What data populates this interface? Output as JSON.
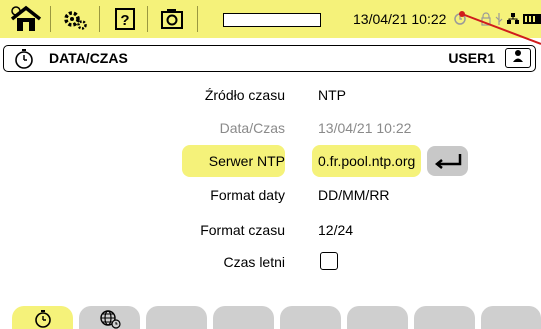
{
  "statusbar": {
    "datetime": "13/04/21 10:22",
    "progress_fraction": 0.0
  },
  "header": {
    "title": "DATA/CZAS",
    "user": "USER1"
  },
  "form": {
    "source_label": "Źródło czasu",
    "source_value": "NTP",
    "datetime_label": "Data/Czas",
    "datetime_value": "13/04/21 10:22",
    "ntp_label": "Serwer NTP",
    "ntp_value": "0.fr.pool.ntp.org",
    "date_format_label": "Format daty",
    "date_format_value": "DD/MM/RR",
    "time_format_label": "Format czasu",
    "time_format_value": "12/24",
    "dst_label": "Czas letni",
    "dst_checked": false
  },
  "tabs": [
    {
      "icon": "clock-icon",
      "active": true
    },
    {
      "icon": "globe-clock-icon",
      "active": false
    },
    {
      "icon": "",
      "active": false
    },
    {
      "icon": "",
      "active": false
    },
    {
      "icon": "",
      "active": false
    },
    {
      "icon": "",
      "active": false
    },
    {
      "icon": "",
      "active": false
    },
    {
      "icon": "",
      "active": false
    }
  ],
  "colors": {
    "accent": "#f5f27a",
    "tab_inactive": "#cfcfcf",
    "button_gray": "#c8c8c8",
    "disabled_text": "#8a8a8a",
    "pointer_line": "#d01c1c"
  }
}
